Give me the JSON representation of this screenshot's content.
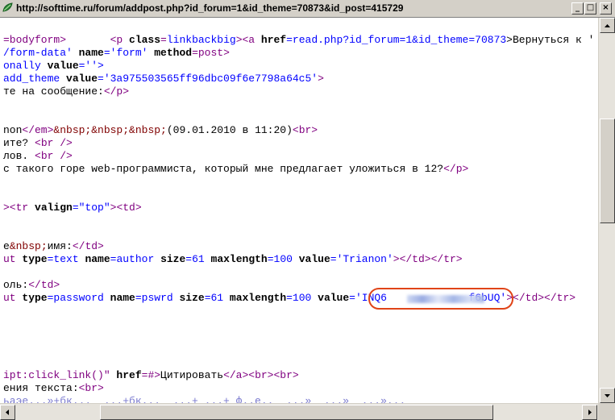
{
  "window": {
    "title": "http://softtime.ru/forum/addpost.php?id_forum=1&id_theme=70873&id_post=415729",
    "buttons": {
      "minimize": "_",
      "maximize": "□",
      "close": "×"
    }
  },
  "source": {
    "l1": {
      "p1": "=bodyform>",
      "p2": "<p ",
      "p3": "class",
      "p4": "=",
      "p5": "linkbackbig",
      "p6": "><a ",
      "p7": "href",
      "p8": "=read.php?id_forum=1&id_theme=70873",
      "p9": ">Вернуться к ",
      "p10": "'"
    },
    "l2": {
      "p1": "/form-data'",
      "p2": " name",
      "p3": "='form'",
      "p4": " method",
      "p5": "=post>"
    },
    "l3": {
      "p1": "onally ",
      "p2": "value",
      "p3": "=''>"
    },
    "l4": {
      "p1": "add_theme ",
      "p2": "value",
      "p3": "='3a975503565ff96dbc09f6e7798a64c5'",
      "p4": ">"
    },
    "l5": {
      "p1": "те на сообщение:",
      "p2": "</p>"
    },
    "l6": {
      "p1": "non",
      "p2": "</em>",
      "p3": "&nbsp;&nbsp;&nbsp;",
      "p4": "(09.01.2010 в 11:20)",
      "p5": "<br>"
    },
    "l7": {
      "p1": "ите? ",
      "p2": "<br />"
    },
    "l8": {
      "p1": "лов. ",
      "p2": "<br />"
    },
    "l9": {
      "p1": "с такого горе web-программиста, который мне предлагает уложиться в 12?",
      "p2": "</p>"
    },
    "l10": {
      "p1": "><tr ",
      "p2": "valign",
      "p3": "=\"top\"",
      "p4": "><td>"
    },
    "l11": {
      "p1": "e",
      "p2": "&nbsp;",
      "p3": "имя:",
      "p4": "</td>"
    },
    "l12": {
      "p1": "ut ",
      "p2": "type",
      "p3": "=text ",
      "p4": "name",
      "p5": "=author ",
      "p6": "size",
      "p7": "=61 ",
      "p8": "maxlength",
      "p9": "=100 ",
      "p10": "value",
      "p11": "='Trianon'",
      "p12": "></td></tr>"
    },
    "l13": {
      "p1": "оль:",
      "p2": "</td>"
    },
    "l14": {
      "p1": "ut ",
      "p2": "type",
      "p3": "=password ",
      "p4": "name",
      "p5": "=pswrd ",
      "p6": "size",
      "p7": "=61 ",
      "p8": "maxlength",
      "p9": "=100 ",
      "p10": "value",
      "p11": "='",
      "p12": "INQ6",
      "p13": "f6bUQ",
      "p14": "'",
      "p15": "></td></tr>"
    },
    "l15": {
      "p1": "ipt:click_link()\"",
      "p2": " href",
      "p3": "=#>",
      "p4": "Цитировать",
      "p5": "</a><br><br>"
    },
    "l16": {
      "p1": "ения текста:",
      "p2": "<br>"
    },
    "l17": {
      "p1": "ьаэе...»+бк...  ...+бк...  ...+ ...+ ф..е..  ...»  ...»  ...»..."
    }
  }
}
